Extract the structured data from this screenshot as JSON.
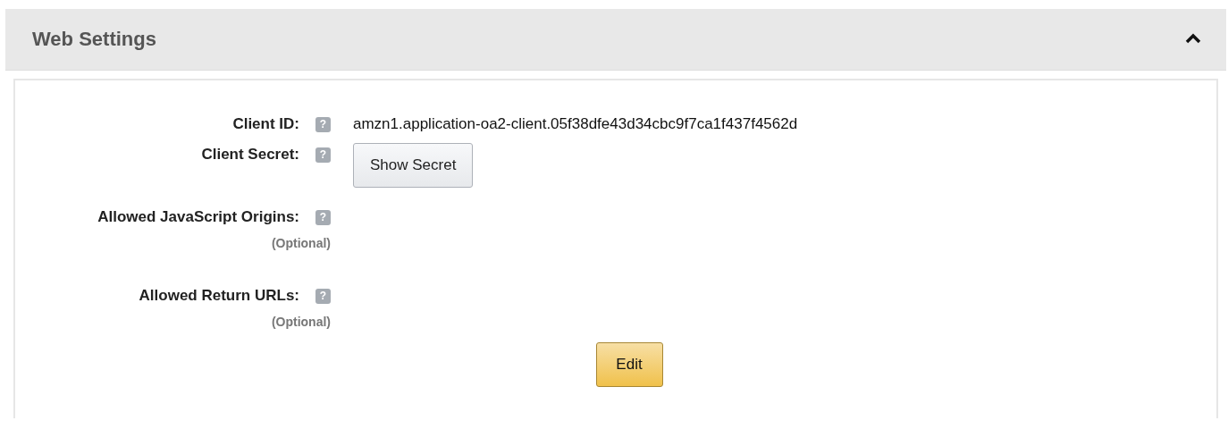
{
  "section": {
    "title": "Web Settings",
    "expanded": true
  },
  "fields": [
    {
      "kind": "text",
      "label": "Client ID:",
      "help": "?",
      "value": "amzn1.application-oa2-client.05f38dfe43d34cbc9f7ca1f437f4562d"
    },
    {
      "kind": "button",
      "label": "Client Secret:",
      "help": "?",
      "button": "Show Secret"
    },
    {
      "kind": "empty",
      "label": "Allowed JavaScript Origins:",
      "help": "?",
      "note": "(Optional)"
    },
    {
      "kind": "empty",
      "label": "Allowed Return URLs:",
      "help": "?",
      "note": "(Optional)"
    }
  ],
  "edit_button": "Edit"
}
